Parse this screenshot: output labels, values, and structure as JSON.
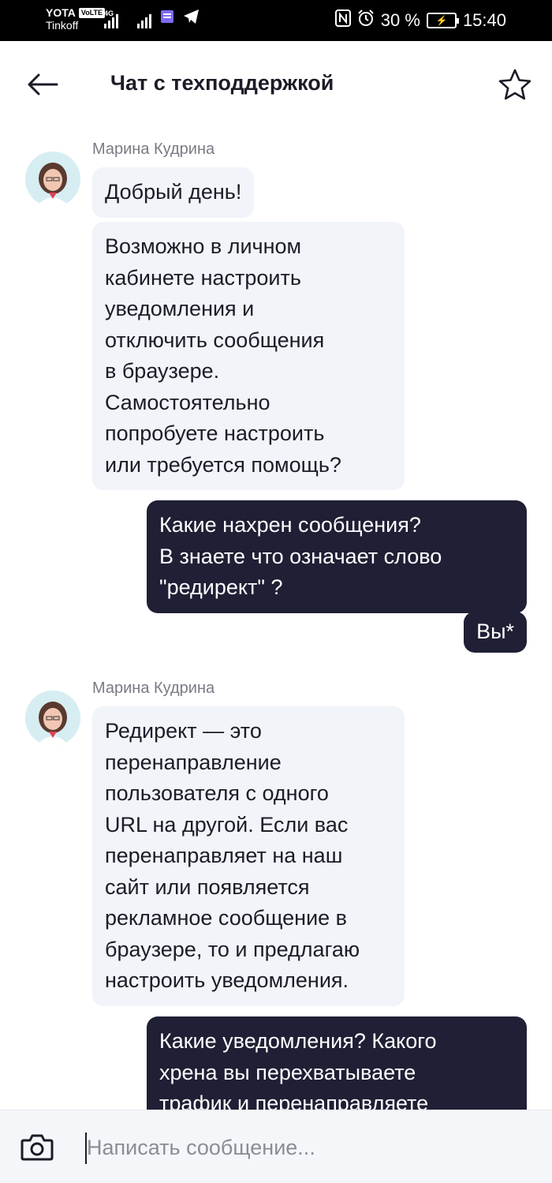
{
  "status_bar": {
    "carrier_top": "YOTA",
    "volte": "VoLTE",
    "carrier_bottom": "Tinkoff",
    "network": "4G",
    "battery_percent": "30 %",
    "time": "15:40",
    "icons": [
      "signal-icon",
      "signal-icon",
      "sim-icon",
      "telegram-icon",
      "nfc-icon",
      "alarm-icon",
      "battery-icon"
    ]
  },
  "header": {
    "title": "Чат с техподдержкой",
    "back_icon": "arrow-left-icon",
    "favorite_icon": "star-icon"
  },
  "messages": [
    {
      "from": "agent",
      "sender": "Марина Кудрина",
      "text": "Добрый день!"
    },
    {
      "from": "agent",
      "text": "Возможно в личном\nкабинете настроить\nуведомления и\nотключить сообщения\nв браузере.\nСамостоятельно\nпопробуете настроить\nили требуется помощь?"
    },
    {
      "from": "user",
      "text": "Какие нахрен сообщения?\nВ знаете что означает слово\n\"редирект\" ?"
    },
    {
      "from": "user",
      "text": "Вы*"
    },
    {
      "from": "agent",
      "sender": "Марина Кудрина",
      "text": "Редирект — это\nперенаправление\nпользователя с одного\nURL на другой. Если вас\nперенаправляет на наш\nсайт или появляется\nрекламное сообщение в\nбраузере, то и предлагаю\nнастроить уведомления."
    },
    {
      "from": "user",
      "text": "Какие уведомления? Какого\nхрена вы перехватываете\nтрафик и перенаправляете"
    }
  ],
  "composer": {
    "placeholder": "Написать сообщение...",
    "value": "",
    "attach_icon": "camera-icon"
  },
  "colors": {
    "incoming_bubble": "#f1f4f8",
    "outgoing_bubble": "#1f1f35",
    "sender_name": "#7a7a85",
    "status_bar": "#000000"
  }
}
